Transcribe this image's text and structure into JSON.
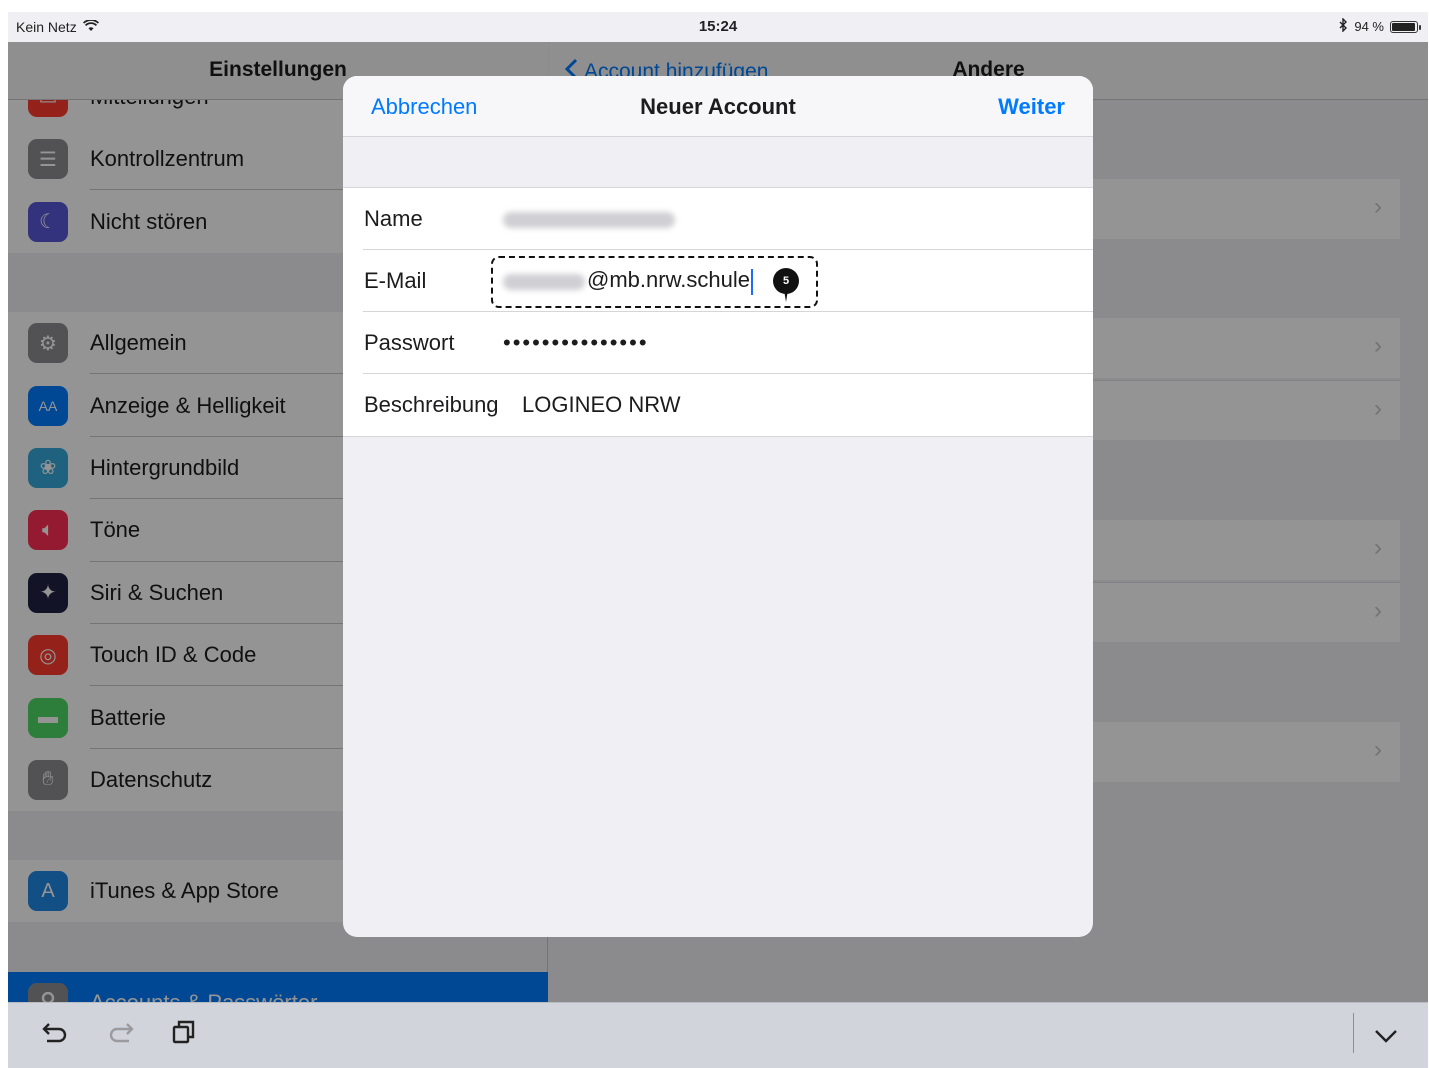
{
  "status_bar": {
    "carrier": "Kein Netz",
    "time": "15:24",
    "battery": "94 %",
    "battery_level": 0.94
  },
  "sidebar": {
    "title": "Einstellungen",
    "partial_top": "Mitteilungen",
    "group1": [
      {
        "label": "Kontrollzentrum",
        "icon": "control-center-icon",
        "color": "#8e8e93"
      },
      {
        "label": "Nicht stören",
        "icon": "moon-icon",
        "color": "#5856d6"
      }
    ],
    "group2": [
      {
        "label": "Allgemein",
        "icon": "gear-icon",
        "color": "#8e8e93"
      },
      {
        "label": "Anzeige & Helligkeit",
        "icon": "display-icon",
        "color": "#007aff"
      },
      {
        "label": "Hintergrundbild",
        "icon": "wallpaper-icon",
        "color": "#34aadc"
      },
      {
        "label": "Töne",
        "icon": "speaker-icon",
        "color": "#ff2d55"
      },
      {
        "label": "Siri & Suchen",
        "icon": "siri-icon",
        "color": "#222244"
      },
      {
        "label": "Touch ID & Code",
        "icon": "fingerprint-icon",
        "color": "#ff3b30"
      },
      {
        "label": "Batterie",
        "icon": "battery-icon",
        "color": "#4cd964"
      },
      {
        "label": "Datenschutz",
        "icon": "hand-icon",
        "color": "#8e8e93"
      }
    ],
    "group3": [
      {
        "label": "iTunes & App Store",
        "icon": "app-store-icon",
        "color": "#1e88e5"
      }
    ],
    "selected": {
      "label": "Accounts & Passwörter",
      "icon": "key-icon",
      "color": "#8e8e93"
    }
  },
  "detail": {
    "back_label": "Account hinzufügen",
    "title": "Andere"
  },
  "modal": {
    "cancel_label": "Abbrechen",
    "title": "Neuer Account",
    "next_label": "Weiter",
    "fields": {
      "name_label": "Name",
      "email_label": "E-Mail",
      "email_value": "@mb.nrw.schule",
      "password_label": "Passwort",
      "password_value": "•••••••••••••••",
      "description_label": "Beschreibung",
      "description_value": "LOGINEO NRW"
    },
    "marker": "5"
  },
  "keyboard_bar": {
    "undo_icon": "undo-icon",
    "redo_icon": "redo-icon",
    "paste_icon": "paste-icon",
    "dismiss_icon": "chevron-down-icon"
  }
}
